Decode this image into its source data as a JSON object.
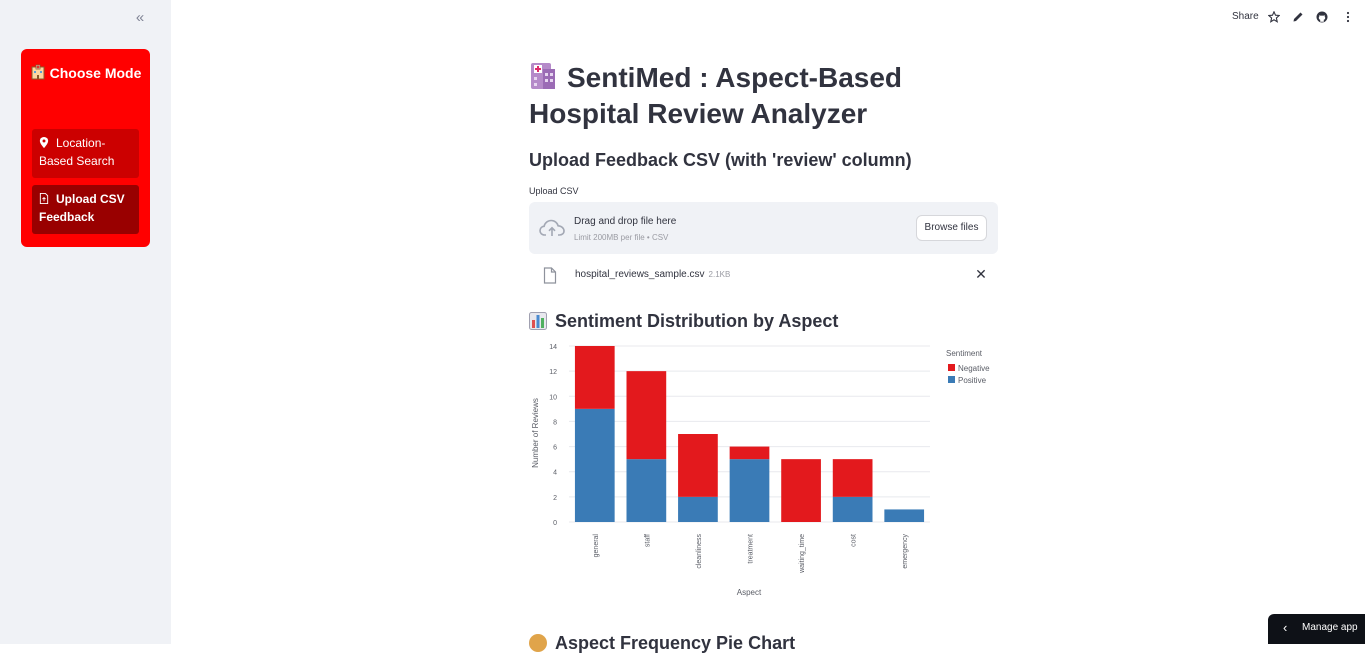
{
  "sidebar": {
    "collapse_icon": "«",
    "mode_card": {
      "title": "Choose Mode",
      "icon": "hospital-icon",
      "bg_color": "#ff0000",
      "buttons": [
        {
          "label": "Location-Based Search",
          "icon": "map-pin-icon",
          "active": false
        },
        {
          "label": "Upload CSV Feedback",
          "icon": "file-upload-icon",
          "active": true
        }
      ]
    }
  },
  "toolbar": {
    "share_label": "Share",
    "icons": [
      "star-icon",
      "pencil-icon",
      "github-icon",
      "more-vertical-icon"
    ]
  },
  "main": {
    "title": "SentiMed : Aspect-Based Hospital Review Analyzer",
    "upload_heading": "Upload Feedback CSV (with 'review' column)",
    "uploader": {
      "label": "Upload CSV",
      "drag_text": "Drag and drop file here",
      "limit_text": "Limit 200MB per file • CSV",
      "browse_label": "Browse files"
    },
    "file": {
      "name": "hospital_reviews_sample.csv",
      "size": "2.1KB"
    },
    "chart_heading": "Sentiment Distribution by Aspect",
    "next_heading": "Aspect Frequency Pie Chart"
  },
  "chart_data": {
    "type": "bar",
    "stacked": true,
    "categories": [
      "general",
      "staff",
      "cleanliness",
      "treatment",
      "waiting_time",
      "cost",
      "emergency"
    ],
    "series": [
      {
        "name": "Positive",
        "color": "#3a7bb6",
        "values": [
          9,
          5,
          2,
          5,
          0,
          2,
          1
        ]
      },
      {
        "name": "Negative",
        "color": "#e3191d",
        "values": [
          5,
          7,
          5,
          1,
          5,
          3,
          0
        ]
      }
    ],
    "xlabel": "Aspect",
    "ylabel": "Number of Reviews",
    "ylim": [
      0,
      14
    ],
    "yticks": [
      0,
      2,
      4,
      6,
      8,
      10,
      12,
      14
    ],
    "legend_title": "Sentiment",
    "legend_position": "right",
    "grid": true
  },
  "manage_app": {
    "label": "Manage app"
  }
}
